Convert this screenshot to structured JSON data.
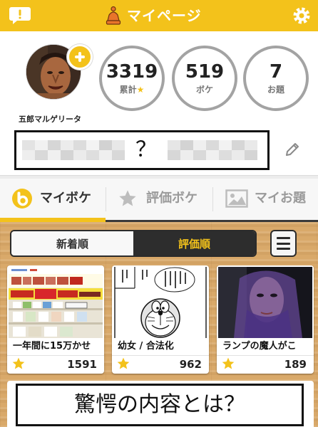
{
  "header": {
    "title": "マイページ",
    "icons": {
      "left": "notification-bubble-icon",
      "center": "bell-icon",
      "right": "gear-icon"
    }
  },
  "profile": {
    "user_name": "五郎マルゲリータ",
    "badge_icon": "add-icon",
    "stats": [
      {
        "value": "3319",
        "label": "累計",
        "label_icon": "★"
      },
      {
        "value": "519",
        "label": "ボケ"
      },
      {
        "value": "7",
        "label": "お題"
      }
    ],
    "bio": {
      "text": "？",
      "edit_icon": "pencil-icon"
    }
  },
  "tabs": [
    {
      "label": "マイボケ",
      "icon": "bokete-b-icon",
      "active": true
    },
    {
      "label": "評価ボケ",
      "icon": "star-icon",
      "active": false
    },
    {
      "label": "マイお題",
      "icon": "image-icon",
      "active": false
    }
  ],
  "sort": {
    "options": [
      "新着順",
      "評価順"
    ],
    "selected_index": 1,
    "menu_icon": "hamburger-menu-icon"
  },
  "cards": [
    {
      "title": "一年間に15万かせ",
      "count": "1591",
      "icon": "star-icon"
    },
    {
      "title": "幼女 / 合法化",
      "count": "962",
      "icon": "star-icon"
    },
    {
      "title": "ランプの魔人がこ",
      "count": "189",
      "icon": "star-icon"
    }
  ],
  "featured": {
    "caption": "驚愕の内容とは？"
  },
  "colors": {
    "brand_yellow": "#F3C21B",
    "dark": "#2D2D2D",
    "inactive_gray": "#999999",
    "wood": "#D9A96A"
  }
}
